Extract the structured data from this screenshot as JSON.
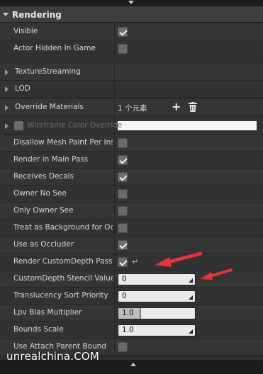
{
  "section": {
    "title": "Rendering"
  },
  "rows": [
    {
      "label": "Visible",
      "type": "checkbox",
      "checked": true
    },
    {
      "label": "Actor Hidden In Game",
      "type": "checkbox",
      "checked": false
    },
    {
      "label": "TextureStreaming",
      "type": "expander"
    },
    {
      "label": "LOD",
      "type": "expander"
    },
    {
      "label": "Override Materials",
      "type": "array",
      "value": "1 个元素"
    },
    {
      "label": "Wireframe Color Override",
      "type": "color"
    },
    {
      "label": "Disallow Mesh Paint Per Instance",
      "type": "checkbox",
      "checked": false
    },
    {
      "label": "Render in Main Pass",
      "type": "checkbox",
      "checked": true
    },
    {
      "label": "Receives Decals",
      "type": "checkbox",
      "checked": true
    },
    {
      "label": "Owner No See",
      "type": "checkbox",
      "checked": false
    },
    {
      "label": "Only Owner See",
      "type": "checkbox",
      "checked": false
    },
    {
      "label": "Treat as Background for Occlusion",
      "type": "checkbox",
      "checked": false
    },
    {
      "label": "Use as Occluder",
      "type": "checkbox",
      "checked": true
    },
    {
      "label": "Render CustomDepth Pass",
      "type": "checkbox",
      "checked": true
    },
    {
      "label": "CustomDepth Stencil Value",
      "type": "number",
      "value": "0"
    },
    {
      "label": "Translucency Sort Priority",
      "type": "number",
      "value": "0"
    },
    {
      "label": "Lpv Bias Multiplier",
      "type": "slider",
      "value": "1.0",
      "fill": 0.3
    },
    {
      "label": "Bounds Scale",
      "type": "number",
      "value": "1.0"
    },
    {
      "label": "Use Attach Parent Bound",
      "type": "checkbox",
      "checked": false
    }
  ],
  "watermark": "unrealchina.COM",
  "colors": {
    "background": "#2f2f2f",
    "accent_arrow": "#e8343a",
    "reset_icon": "#e8c44b"
  }
}
